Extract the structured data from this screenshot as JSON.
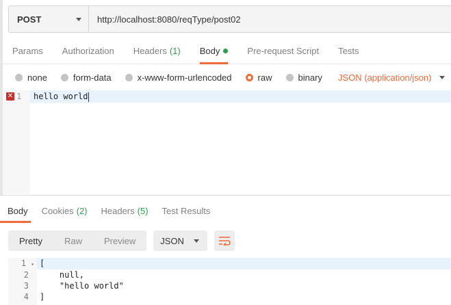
{
  "request": {
    "method": "POST",
    "url": "http://localhost:8080/reqType/post02"
  },
  "request_tabs": [
    {
      "label": "Params"
    },
    {
      "label": "Authorization"
    },
    {
      "label": "Headers",
      "count": "(1)"
    },
    {
      "label": "Body"
    },
    {
      "label": "Pre-request Script"
    },
    {
      "label": "Tests"
    }
  ],
  "body_types": [
    {
      "label": "none",
      "checked": false
    },
    {
      "label": "form-data",
      "checked": false
    },
    {
      "label": "x-www-form-urlencoded",
      "checked": false
    },
    {
      "label": "raw",
      "checked": true
    },
    {
      "label": "binary",
      "checked": false
    }
  ],
  "content_type": "JSON (application/json)",
  "editor": {
    "line_number": "1",
    "error_marker": "✕",
    "content": "hello world"
  },
  "response_tabs": [
    {
      "label": "Body"
    },
    {
      "label": "Cookies",
      "count": "(2)"
    },
    {
      "label": "Headers",
      "count": "(5)"
    },
    {
      "label": "Test Results"
    }
  ],
  "response_view": {
    "modes": [
      "Pretty",
      "Raw",
      "Preview"
    ],
    "format": "JSON"
  },
  "response_lines": [
    {
      "n": "1",
      "text": "["
    },
    {
      "n": "2",
      "text": "    null,"
    },
    {
      "n": "3",
      "text": "    \"hello world\""
    },
    {
      "n": "4",
      "text": "]"
    }
  ],
  "colors": {
    "accent": "#f26b3a",
    "count_green": "#2ca04d",
    "error_red": "#c8302b",
    "string_blue": "#1a1aa6"
  }
}
